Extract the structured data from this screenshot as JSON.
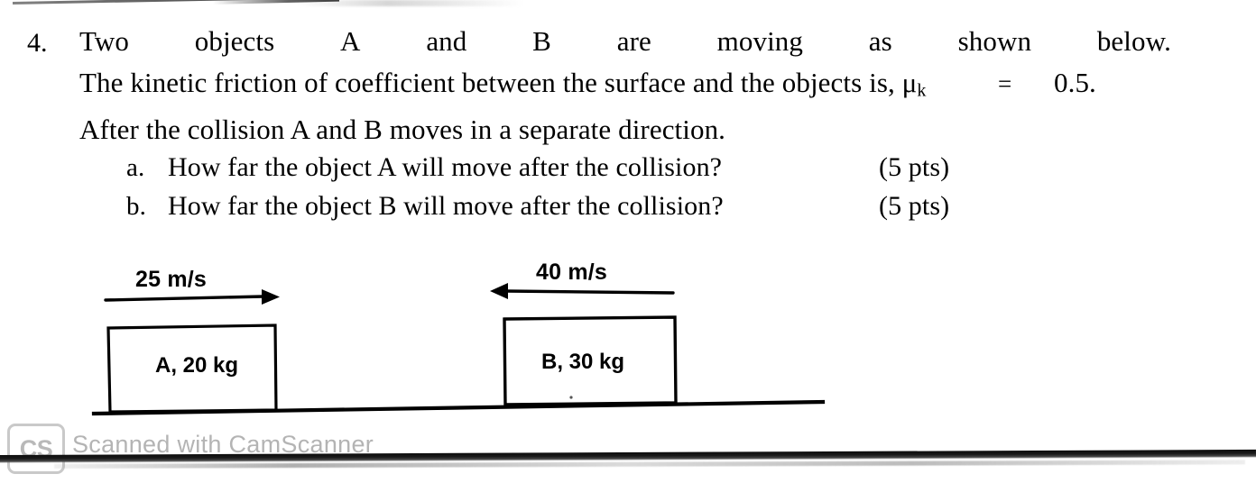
{
  "question": {
    "number": "4.",
    "line1_words": [
      "Two",
      "objects",
      "A",
      "and",
      "B",
      "are",
      "moving",
      "as",
      "shown",
      "below."
    ],
    "line2_prefix": "The kinetic friction of coefficient between the surface and the objects is, μ",
    "line2_subscript": "k",
    "line2_equals": "=",
    "line2_value": "0.5.",
    "line3": "After the collision A and B moves in a separate direction.",
    "sub_items": [
      {
        "marker": "a.",
        "text": "How far the object A will move after the collision?",
        "points": "(5 pts)"
      },
      {
        "marker": "b.",
        "text": "How far the object B will move after the collision?",
        "points": "(5 pts)"
      }
    ]
  },
  "diagram": {
    "object_a": {
      "velocity_label": "25 m/s",
      "body_label": "A, 20 kg",
      "direction": "right"
    },
    "object_b": {
      "velocity_label": "40 m/s",
      "body_label": "B, 30 kg",
      "direction": "left"
    }
  },
  "watermark": {
    "logo_text": "CS",
    "text": "Scanned with CamScanner"
  }
}
